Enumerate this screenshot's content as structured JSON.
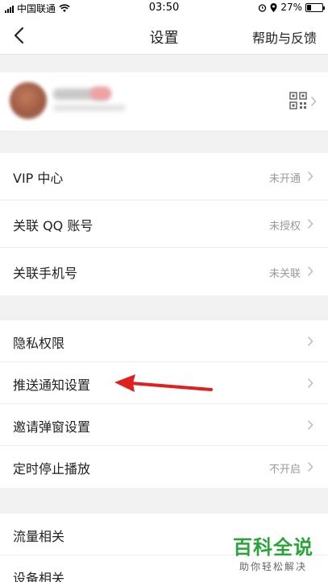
{
  "status_bar": {
    "carrier": "中国联通",
    "time": "03:50",
    "battery": "27%",
    "battery_level": 0.27
  },
  "nav": {
    "title": "设置",
    "help": "帮助与反馈"
  },
  "groups": [
    {
      "items": [
        {
          "label": "VIP 中心",
          "value": "未开通"
        },
        {
          "label": "关联 QQ 账号",
          "value": "未授权"
        },
        {
          "label": "关联手机号",
          "value": "未关联"
        }
      ]
    },
    {
      "items": [
        {
          "label": "隐私权限",
          "value": ""
        },
        {
          "label": "推送通知设置",
          "value": ""
        },
        {
          "label": "邀请弹窗设置",
          "value": ""
        },
        {
          "label": "定时停止播放",
          "value": "不开启"
        }
      ]
    },
    {
      "items": [
        {
          "label": "流量相关",
          "value": ""
        },
        {
          "label": "设备相关",
          "value": ""
        }
      ]
    }
  ],
  "watermark": {
    "main": "百科全说",
    "sub": "助你轻松解决"
  },
  "colors": {
    "arrow": "#e02020",
    "watermark": "#2aa33a",
    "page_bg": "#f2f2f2"
  }
}
